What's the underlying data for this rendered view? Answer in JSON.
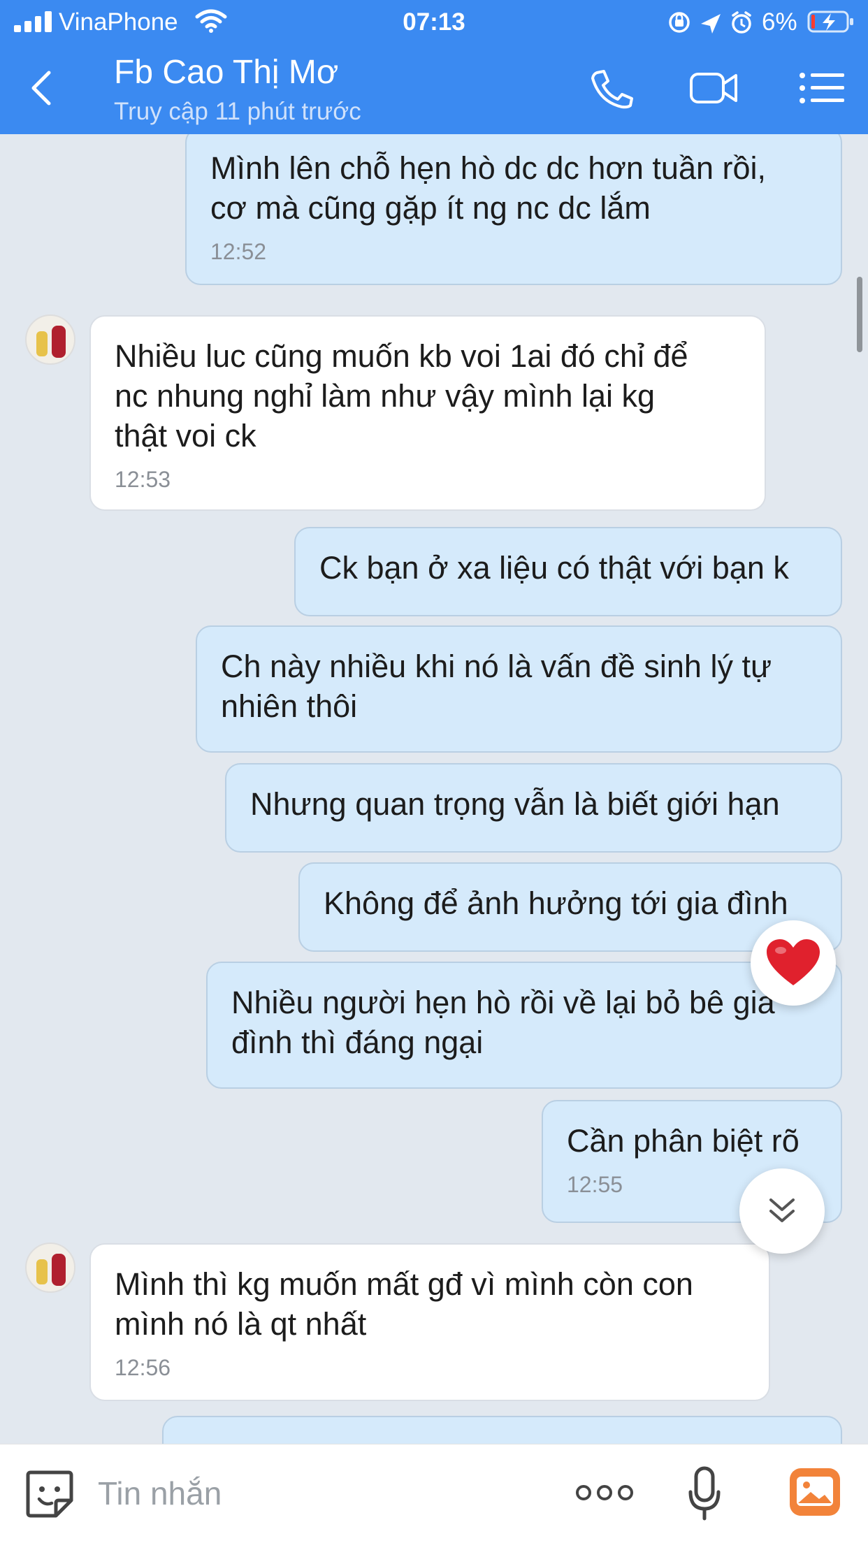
{
  "status_bar": {
    "carrier": "VinaPhone",
    "time": "07:13",
    "battery": "6%"
  },
  "header": {
    "title": "Fb Cao Thị Mơ",
    "subtitle": "Truy cập 11 phút trước"
  },
  "messages": [
    {
      "dir": "out",
      "text": "Mình lên chỗ hẹn hò dc dc hơn tuần rồi,\ncơ mà cũng gặp ít ng nc dc lắm",
      "time": "12:52"
    },
    {
      "dir": "in",
      "text": "Nhiều luc cũng muốn kb voi 1ai đó chỉ để\nnc nhung nghỉ làm như vậy mình lại kg\nthật voi ck",
      "time": "12:53"
    },
    {
      "dir": "out",
      "text": "Ck bạn ở xa liệu có thật với bạn k",
      "time": ""
    },
    {
      "dir": "out",
      "text": "Ch này nhiều khi nó là vấn đề sinh lý tự\nnhiên thôi",
      "time": ""
    },
    {
      "dir": "out",
      "text": "Nhưng quan trọng vẫn là biết giới hạn",
      "time": ""
    },
    {
      "dir": "out",
      "text": "Không để ảnh hưởng tới gia đình",
      "time": ""
    },
    {
      "dir": "out",
      "text": "Nhiều người hẹn hò rồi về lại bỏ bê gia\nđình thì đáng ngại",
      "time": ""
    },
    {
      "dir": "out",
      "text": "Cần phân biệt rõ",
      "time": "12:55"
    },
    {
      "dir": "in",
      "text": "Mình thì kg muốn mất gđ vì mình còn con\nmình nó là qt nhất",
      "time": "12:56"
    }
  ],
  "input": {
    "placeholder": "Tin nhắn"
  },
  "icons": {
    "back": "chevron-left-icon",
    "call": "phone-icon",
    "video": "video-camera-icon",
    "menu": "menu-list-icon",
    "reaction": "heart-icon",
    "scroll": "double-chevron-down-icon",
    "sticker": "sticker-face-icon",
    "more": "more-dots-icon",
    "voice": "microphone-icon",
    "photo": "photo-gallery-icon"
  },
  "colors": {
    "header": "#3b8af1",
    "bubble_out": "#d5eafb",
    "bubble_in": "#ffffff",
    "heart": "#e0212d",
    "photo_icon": "#f2833a"
  }
}
